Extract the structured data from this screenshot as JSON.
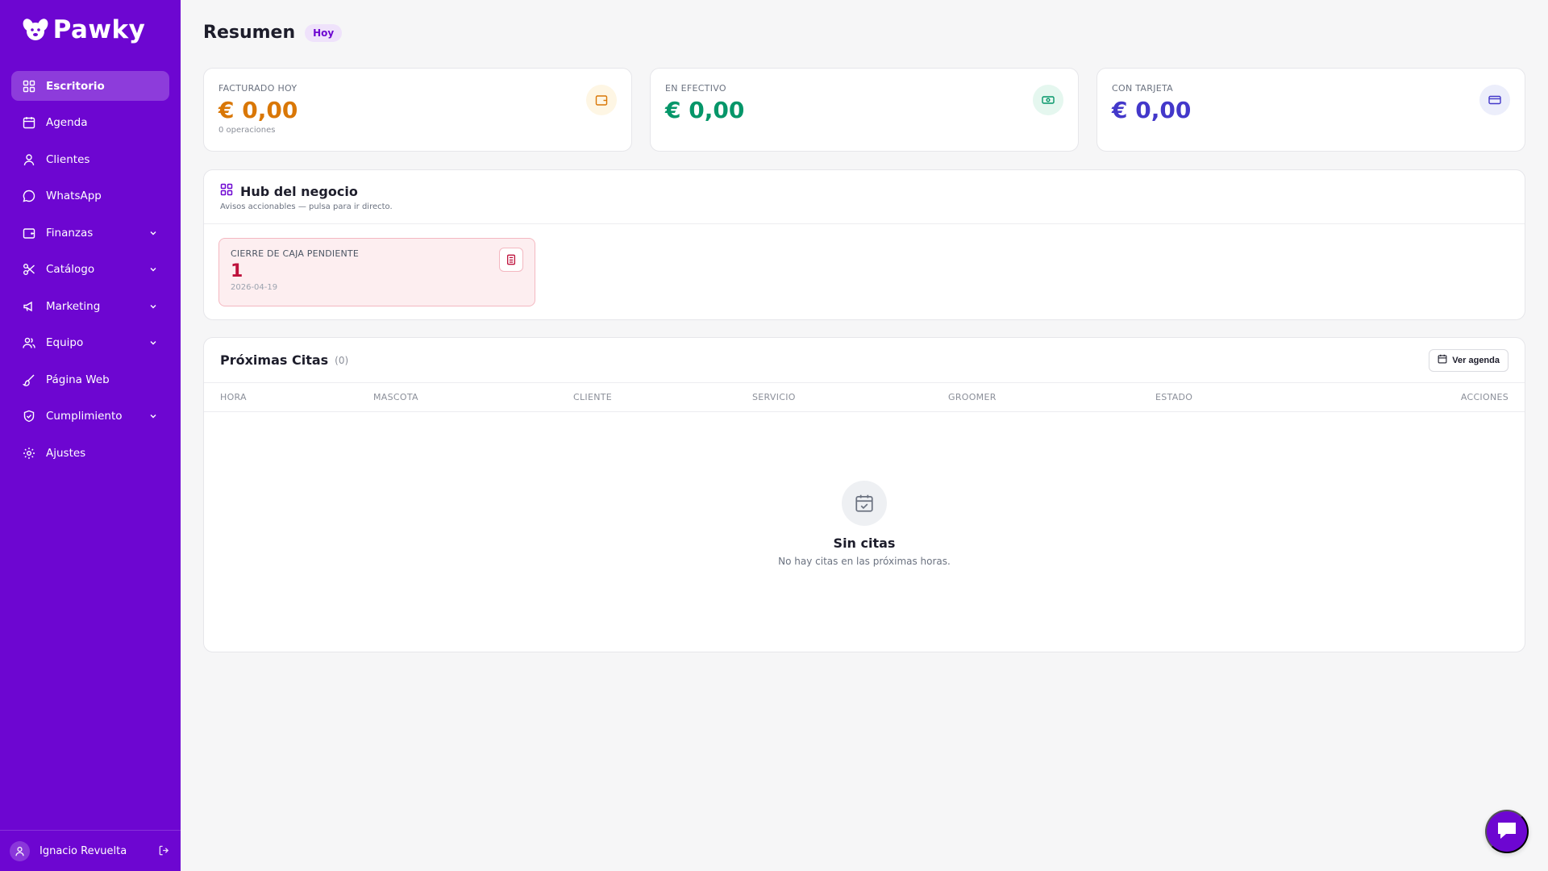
{
  "app": {
    "name": "Pawky"
  },
  "sidebar": {
    "items": [
      {
        "label": "Escritorio",
        "icon": "dashboard-icon",
        "active": true
      },
      {
        "label": "Agenda",
        "icon": "calendar-icon"
      },
      {
        "label": "Clientes",
        "icon": "user-icon"
      },
      {
        "label": "WhatsApp",
        "icon": "chat-bubble-icon"
      },
      {
        "label": "Finanzas",
        "icon": "wallet-icon",
        "expandable": true
      },
      {
        "label": "Catálogo",
        "icon": "scissors-icon",
        "expandable": true
      },
      {
        "label": "Marketing",
        "icon": "megaphone-icon",
        "expandable": true
      },
      {
        "label": "Equipo",
        "icon": "users-icon",
        "expandable": true
      },
      {
        "label": "Página Web",
        "icon": "brush-icon"
      },
      {
        "label": "Cumplimiento",
        "icon": "shield-icon",
        "expandable": true
      },
      {
        "label": "Ajustes",
        "icon": "gear-icon"
      }
    ],
    "user": {
      "name": "Ignacio Revuelta"
    }
  },
  "header": {
    "title": "Resumen",
    "badge": "Hoy"
  },
  "stats": [
    {
      "label": "FACTURADO HOY",
      "value": "€ 0,00",
      "sub": "0 operaciones",
      "color": "#d97706",
      "icon": "wallet-icon"
    },
    {
      "label": "EN EFECTIVO",
      "value": "€ 0,00",
      "color": "#059669",
      "icon": "cash-icon"
    },
    {
      "label": "CON TARJETA",
      "value": "€ 0,00",
      "color": "#4338ca",
      "icon": "credit-card-icon"
    }
  ],
  "hub": {
    "title": "Hub del negocio",
    "subtitle": "Avisos accionables — pulsa para ir directo.",
    "alert": {
      "label": "CIERRE DE CAJA PENDIENTE",
      "count": "1",
      "date": "2026-04-19"
    }
  },
  "citas": {
    "title": "Próximas Citas",
    "count": "(0)",
    "button": "Ver agenda",
    "columns": [
      "HORA",
      "MASCOTA",
      "CLIENTE",
      "SERVICIO",
      "GROOMER",
      "ESTADO",
      "ACCIONES"
    ],
    "empty_title": "Sin citas",
    "empty_sub": "No hay citas en las próximas horas."
  },
  "colors": {
    "brand": "#6d06d1",
    "alert": "#be123c"
  }
}
